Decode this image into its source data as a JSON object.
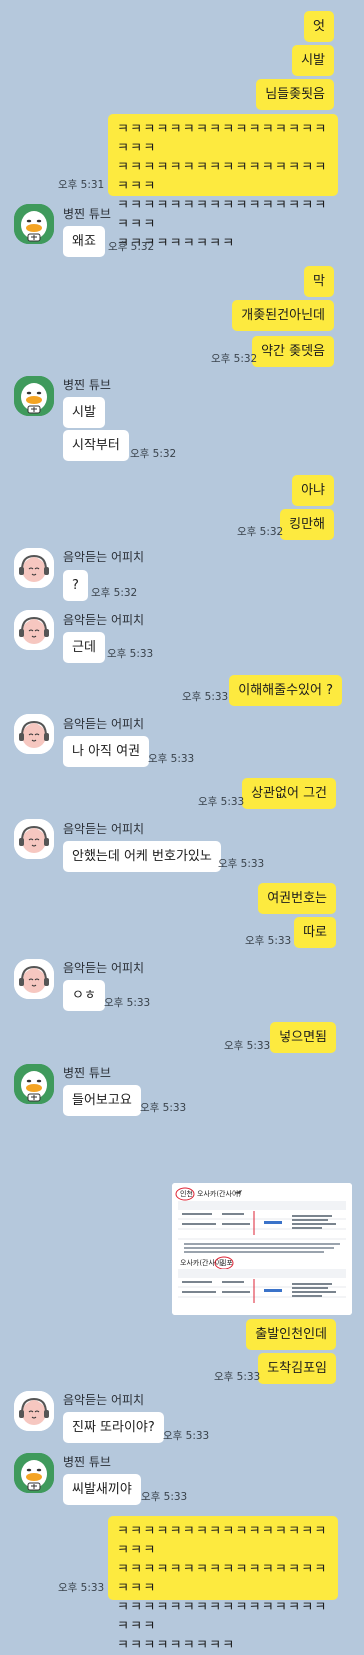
{
  "messages": {
    "m1": "엇",
    "m2": "시발",
    "m3": "님들좆됫음",
    "m4": "ㅋㅋㅋㅋㅋㅋㅋㅋㅋㅋㅋㅋㅋㅋㅋㅋㅋㅋㅋ\nㅋㅋㅋㅋㅋㅋㅋㅋㅋㅋㅋㅋㅋㅋㅋㅋㅋㅋㅋ\nㅋㅋㅋㅋㅋㅋㅋㅋㅋㅋㅋㅋㅋㅋㅋㅋㅋㅋㅋ\nㅋㅋㅋㅋㅋㅋㅋㅋㅋ",
    "t4": "오후 5:31",
    "n5": "병찐 튜브",
    "m5": "왜죠",
    "t5": "오후 5:32",
    "m6": "막",
    "m7": "개좆된건아닌데",
    "m8": "약간 좆뎃음",
    "t8": "오후 5:32",
    "n9": "병찐 튜브",
    "m9": "시발",
    "m10": "시작부터",
    "t10": "오후 5:32",
    "m11": "아냐",
    "m12": "킹만해",
    "t12": "오후 5:32",
    "n13": "음악듣는 어피치",
    "m13": "?",
    "t13": "오후 5:32",
    "n14": "음악듣는 어피치",
    "m14": "근데",
    "t14": "오후 5:33",
    "m15": "이해해줄수있어 ?",
    "t15": "오후 5:33",
    "n16": "음악듣는 어피치",
    "m16": "나 아직 여권",
    "t16": "오후 5:33",
    "m17": "상관없어 그건",
    "t17": "오후 5:33",
    "n18": "음악듣는 어피치",
    "m18": "안했는데 어케 번호가있노",
    "t18": "오후 5:33",
    "m19": "여권번호는",
    "m20": "따로",
    "t20": "오후 5:33",
    "n21": "음악듣는 어피치",
    "m21": "ㅇㅎ",
    "t21": "오후 5:33",
    "m22": "넣으면됨",
    "t22": "오후 5:33",
    "n23": "병찐 튜브",
    "m23": "들어보고요",
    "t23": "오후 5:33",
    "img": {
      "h1": "인천",
      "h2": "오사카(간사이)",
      "h3": "오사카(간사이)",
      "h4": "김포"
    },
    "m24": "출발인천인데",
    "m25": "도착김포임",
    "t25": "오후 5:33",
    "n26": "음악듣는 어피치",
    "m26": "진짜 또라이야?",
    "t26": "오후 5:33",
    "n27": "병찐 튜브",
    "m27": "씨발새끼야",
    "t27": "오후 5:33",
    "m28": "ㅋㅋㅋㅋㅋㅋㅋㅋㅋㅋㅋㅋㅋㅋㅋㅋㅋㅋㅋ\nㅋㅋㅋㅋㅋㅋㅋㅋㅋㅋㅋㅋㅋㅋㅋㅋㅋㅋㅋ\nㅋㅋㅋㅋㅋㅋㅋㅋㅋㅋㅋㅋㅋㅋㅋㅋㅋㅋㅋ\nㅋㅋㅋㅋㅋㅋㅋㅋㅋ",
    "t28": "오후 5:33"
  },
  "avatars": {
    "duck": "duck-avatar-icon",
    "apeach": "apeach-avatar-icon"
  },
  "colors": {
    "background": "#b5c8dc",
    "outgoing": "#fdea3f",
    "incoming": "#ffffff",
    "duck_avatar_bg": "#3f9a5c"
  }
}
